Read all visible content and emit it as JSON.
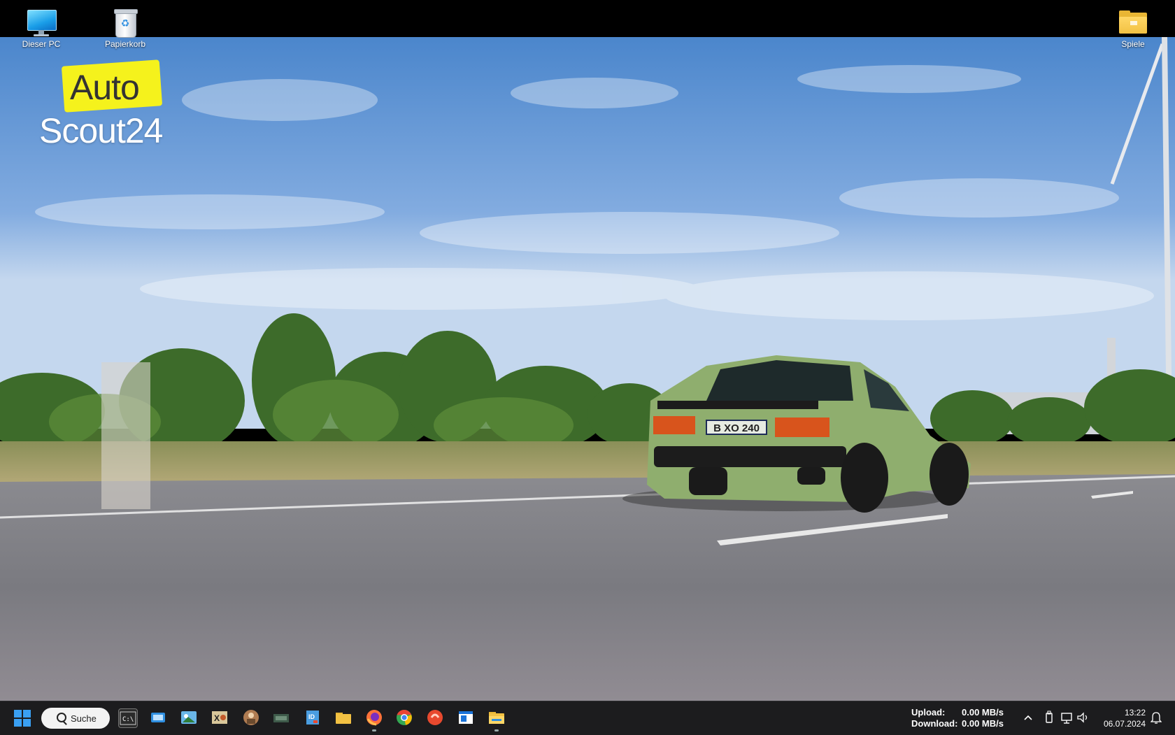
{
  "desktop": {
    "icons": [
      {
        "label": "Dieser PC",
        "icon": "monitor-icon"
      },
      {
        "label": "Papierkorb",
        "icon": "recycle-bin-icon"
      },
      {
        "label": "Spiele",
        "icon": "folder-icon"
      }
    ]
  },
  "wallpaper": {
    "logo_line1": "Auto",
    "logo_line2": "Scout24",
    "license_plate": "B XO 240"
  },
  "taskbar": {
    "search_label": "Suche",
    "pinned": [
      {
        "name": "terminal-icon",
        "color": "#2b2b2b"
      },
      {
        "name": "remote-desktop-icon",
        "color": "#2f8fe0"
      },
      {
        "name": "photos-icon",
        "color": "#6ab6e8"
      },
      {
        "name": "xnview-icon",
        "color": "#d9c79a"
      },
      {
        "name": "app-avatar-icon",
        "color": "#b07c52"
      },
      {
        "name": "gpu-tool-icon",
        "color": "#3e5a4a"
      },
      {
        "name": "id-app-icon",
        "color": "#4a9de0"
      },
      {
        "name": "file-explorer-icon",
        "color": "#f2c143"
      },
      {
        "name": "firefox-icon",
        "color": "#ff7139"
      },
      {
        "name": "chrome-icon",
        "color": "#34a853"
      },
      {
        "name": "media-player-icon",
        "color": "#e8492e"
      },
      {
        "name": "window-app-icon",
        "color": "#1a73d9"
      },
      {
        "name": "folder-app-icon",
        "color": "#f2c143"
      }
    ],
    "net_speed": {
      "upload_label": "Upload:",
      "upload_value": "0.00 MB/s",
      "download_label": "Download:",
      "download_value": "0.00 MB/s"
    },
    "clock": {
      "time": "13:22",
      "date": "06.07.2024"
    }
  }
}
